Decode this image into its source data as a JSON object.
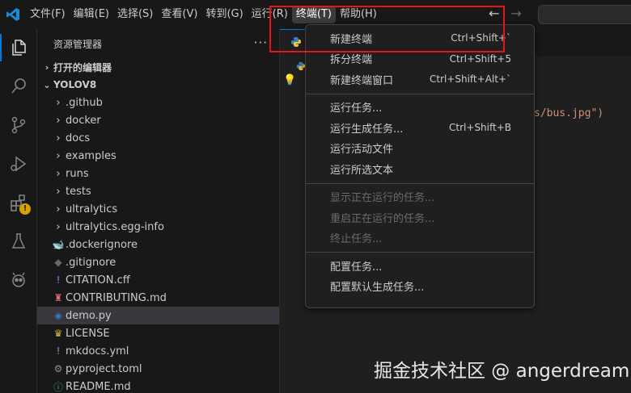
{
  "menubar": {
    "items": [
      "文件(F)",
      "编辑(E)",
      "选择(S)",
      "查看(V)",
      "转到(G)",
      "运行(R)",
      "终端(T)",
      "帮助(H)"
    ],
    "active_index": 6
  },
  "sidebar": {
    "title": "资源管理器",
    "more": "···",
    "open_editors": "打开的编辑器",
    "workspace": "YOLOV8",
    "items": [
      {
        "label": ".github",
        "type": "folder",
        "icon": "chevron-right-icon"
      },
      {
        "label": "docker",
        "type": "folder",
        "icon": "chevron-right-icon"
      },
      {
        "label": "docs",
        "type": "folder",
        "icon": "chevron-right-icon"
      },
      {
        "label": "examples",
        "type": "folder",
        "icon": "chevron-right-icon"
      },
      {
        "label": "runs",
        "type": "folder",
        "icon": "chevron-right-icon"
      },
      {
        "label": "tests",
        "type": "folder",
        "icon": "chevron-right-icon"
      },
      {
        "label": "ultralytics",
        "type": "folder",
        "icon": "chevron-right-icon"
      },
      {
        "label": "ultralytics.egg-info",
        "type": "folder",
        "icon": "chevron-right-icon"
      },
      {
        "label": ".dockerignore",
        "type": "file",
        "icon": "docker-icon"
      },
      {
        "label": ".gitignore",
        "type": "file",
        "icon": "git-icon"
      },
      {
        "label": "CITATION.cff",
        "type": "file",
        "icon": "info-exclaim-icon"
      },
      {
        "label": "CONTRIBUTING.md",
        "type": "file",
        "icon": "contributing-icon"
      },
      {
        "label": "demo.py",
        "type": "file",
        "icon": "python-icon"
      },
      {
        "label": "LICENSE",
        "type": "file",
        "icon": "license-icon"
      },
      {
        "label": "mkdocs.yml",
        "type": "file",
        "icon": "info-exclaim-icon"
      },
      {
        "label": "pyproject.toml",
        "type": "file",
        "icon": "gear-icon"
      },
      {
        "label": "README.md",
        "type": "file",
        "icon": "info-circle-icon"
      }
    ]
  },
  "editor": {
    "code_fragment": "s/bus.jpg\")"
  },
  "terminal_menu": {
    "groups": [
      [
        {
          "label": "新建终端",
          "shortcut": "Ctrl+Shift+`",
          "disabled": false
        },
        {
          "label": "拆分终端",
          "shortcut": "Ctrl+Shift+5",
          "disabled": false
        },
        {
          "label": "新建终端窗口",
          "shortcut": "Ctrl+Shift+Alt+`",
          "disabled": false
        }
      ],
      [
        {
          "label": "运行任务...",
          "shortcut": "",
          "disabled": false
        },
        {
          "label": "运行生成任务...",
          "shortcut": "Ctrl+Shift+B",
          "disabled": false
        },
        {
          "label": "运行活动文件",
          "shortcut": "",
          "disabled": false
        },
        {
          "label": "运行所选文本",
          "shortcut": "",
          "disabled": false
        }
      ],
      [
        {
          "label": "显示正在运行的任务...",
          "shortcut": "",
          "disabled": true
        },
        {
          "label": "重启正在运行的任务...",
          "shortcut": "",
          "disabled": true
        },
        {
          "label": "终止任务...",
          "shortcut": "",
          "disabled": true
        }
      ],
      [
        {
          "label": "配置任务...",
          "shortcut": "",
          "disabled": false
        },
        {
          "label": "配置默认生成任务...",
          "shortcut": "",
          "disabled": false
        }
      ]
    ]
  },
  "watermark": "掘金技术社区 @ angerdream",
  "colors": {
    "accent": "#0078d4",
    "highlight_box": "#e0161b",
    "warning": "#d7a100"
  }
}
